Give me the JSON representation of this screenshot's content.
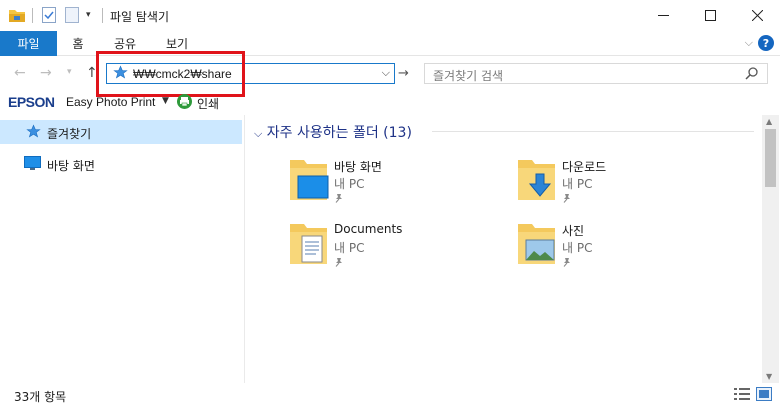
{
  "window": {
    "title": "파일 탐색기",
    "controls": [
      "minimize",
      "maximize",
      "close"
    ]
  },
  "ribbon": {
    "tabs": [
      "파일",
      "홈",
      "공유",
      "보기"
    ],
    "help_label": "?"
  },
  "nav": {
    "address": "₩₩cmck2₩share",
    "search_placeholder": "즐겨찾기 검색"
  },
  "epson": {
    "logo": "EPSON",
    "app": "Easy Photo Print",
    "print_label": "인쇄"
  },
  "navpane": {
    "items": [
      {
        "label": "즐겨찾기",
        "icon": "star-icon",
        "selected": true
      },
      {
        "label": "바탕 화면",
        "icon": "desktop-icon",
        "selected": false
      }
    ]
  },
  "content": {
    "group_title": "자주 사용하는 폴더 (13)",
    "folders": [
      {
        "name": "바탕 화면",
        "location": "내 PC",
        "icon": "desktop-folder-icon"
      },
      {
        "name": "다운로드",
        "location": "내 PC",
        "icon": "downloads-folder-icon"
      },
      {
        "name": "Documents",
        "location": "내 PC",
        "icon": "documents-folder-icon"
      },
      {
        "name": "사진",
        "location": "내 PC",
        "icon": "pictures-folder-icon"
      }
    ]
  },
  "status": {
    "count": "33개 항목"
  },
  "colors": {
    "accent": "#1979ca",
    "selection": "#cce8ff",
    "highlight": "#e0131a",
    "group_header": "#1e3287"
  }
}
